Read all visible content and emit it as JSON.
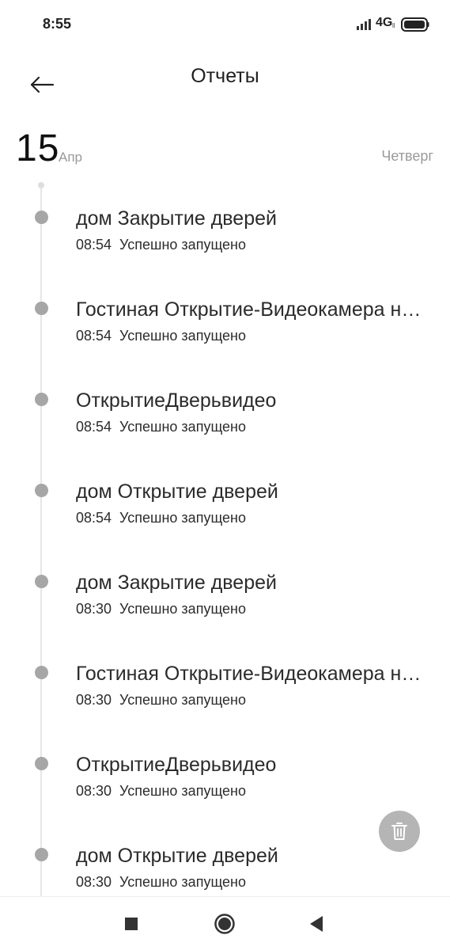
{
  "status_bar": {
    "time": "8:55",
    "network": "4G",
    "network_sub": "ll"
  },
  "header": {
    "title": "Отчеты",
    "back_icon": "arrow-left-icon"
  },
  "date": {
    "day": "15",
    "month": "Апр",
    "weekday": "Четверг"
  },
  "logs": [
    {
      "title": "дом Закрытие дверей",
      "time": "08:54",
      "status": "Успешно запущено"
    },
    {
      "title": "Гостиная Открытие-Видеокамера на входе",
      "time": "08:54",
      "status": "Успешно запущено"
    },
    {
      "title": "ОткрытиеДверьвидео",
      "time": "08:54",
      "status": "Успешно запущено"
    },
    {
      "title": "дом Открытие дверей",
      "time": "08:54",
      "status": "Успешно запущено"
    },
    {
      "title": "дом Закрытие дверей",
      "time": "08:30",
      "status": "Успешно запущено"
    },
    {
      "title": "Гостиная Открытие-Видеокамера на входе",
      "time": "08:30",
      "status": "Успешно запущено"
    },
    {
      "title": "ОткрытиеДверьвидео",
      "time": "08:30",
      "status": "Успешно запущено"
    },
    {
      "title": "дом Открытие дверей",
      "time": "08:30",
      "status": "Успешно запущено"
    }
  ],
  "fab": {
    "icon": "trash-icon"
  },
  "colors": {
    "dot": "#a6a6a6",
    "line": "#e6e6e6",
    "fab": "#b5b5b5",
    "muted_text": "#9a9a9a"
  }
}
